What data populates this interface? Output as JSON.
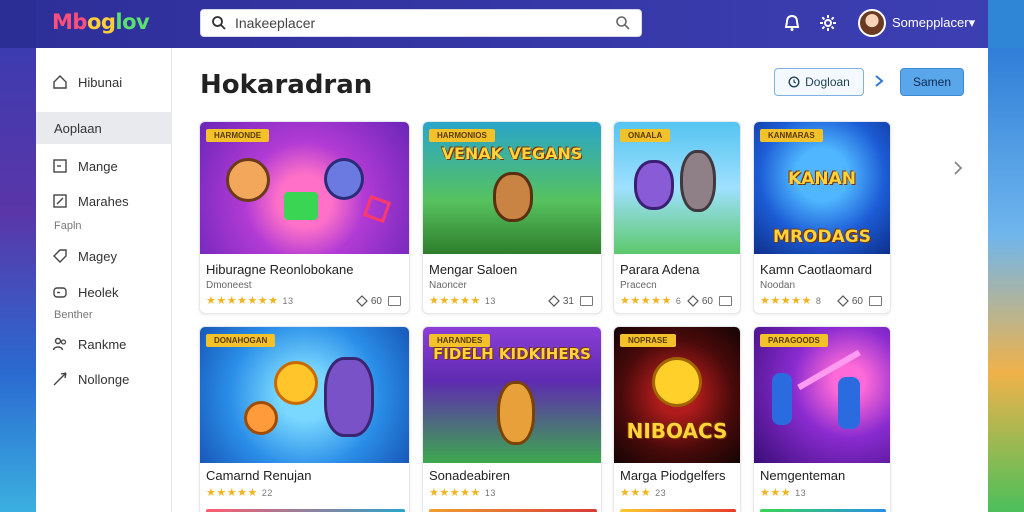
{
  "app": {
    "logo": [
      "Mb",
      "og",
      "lov"
    ]
  },
  "search": {
    "value": "Inakeeplacer"
  },
  "user": {
    "name": "Somepplacer▾"
  },
  "sidebar": {
    "items": [
      {
        "label": "Hibunai"
      },
      {
        "label": "Aoplaan"
      },
      {
        "label": "Mange"
      },
      {
        "label": "Marahes"
      },
      {
        "label": "Magey"
      },
      {
        "label": "Heolek"
      },
      {
        "label": "Rankme"
      },
      {
        "label": "Nollonge"
      }
    ],
    "categories": [
      "Fapln",
      "Benther"
    ]
  },
  "main": {
    "title": "Hokaradran",
    "btn_outline": "Dogloan",
    "btn_primary": "Samen"
  },
  "cards": [
    {
      "ribbon": "HARMONDE",
      "title": "Hiburagne Reonlobokane",
      "sub": "Dmoneest",
      "stars": "★★★★★★★",
      "count": "13",
      "meta": "60"
    },
    {
      "ribbon": "HARMONIOS",
      "title": "Mengar Saloen",
      "sub": "Naoncer",
      "stars": "★★★★★",
      "count": "13",
      "meta": "31",
      "thumb_text": "VENAK VEGANS"
    },
    {
      "ribbon": "ONAALA",
      "title": "Parara Adena",
      "sub": "Pracecn",
      "stars": "★★★★★",
      "count": "6",
      "meta": "60"
    },
    {
      "ribbon": "KANMARAS",
      "title": "Kamn Caotlaomard",
      "sub": "Noodan",
      "stars": "★★★★★",
      "count": "8",
      "meta": "60",
      "thumb_text": "KANAN MRODAGS"
    },
    {
      "ribbon": "DONAHOGAN",
      "title": "Camarnd Renujan",
      "sub": "",
      "stars": "★★★★★",
      "count": "22",
      "meta": ""
    },
    {
      "ribbon": "HARANDES",
      "title": "Sonadeabiren",
      "sub": "",
      "stars": "★★★★★",
      "count": "13",
      "meta": "",
      "thumb_text": "FIDELH KIDKIHERS"
    },
    {
      "ribbon": "NOPRASE",
      "title": "Marga Piodgelfers",
      "sub": "",
      "stars": "★★★",
      "count": "23",
      "meta": "",
      "thumb_text": "NIBOACS"
    },
    {
      "ribbon": "PARAGOODS",
      "title": "Nemgenteman",
      "sub": "",
      "stars": "★★★",
      "count": "13",
      "meta": ""
    }
  ],
  "colors": {
    "accent": "#5aa6ea",
    "header": "#2f2f9a",
    "star": "#f0b420"
  }
}
